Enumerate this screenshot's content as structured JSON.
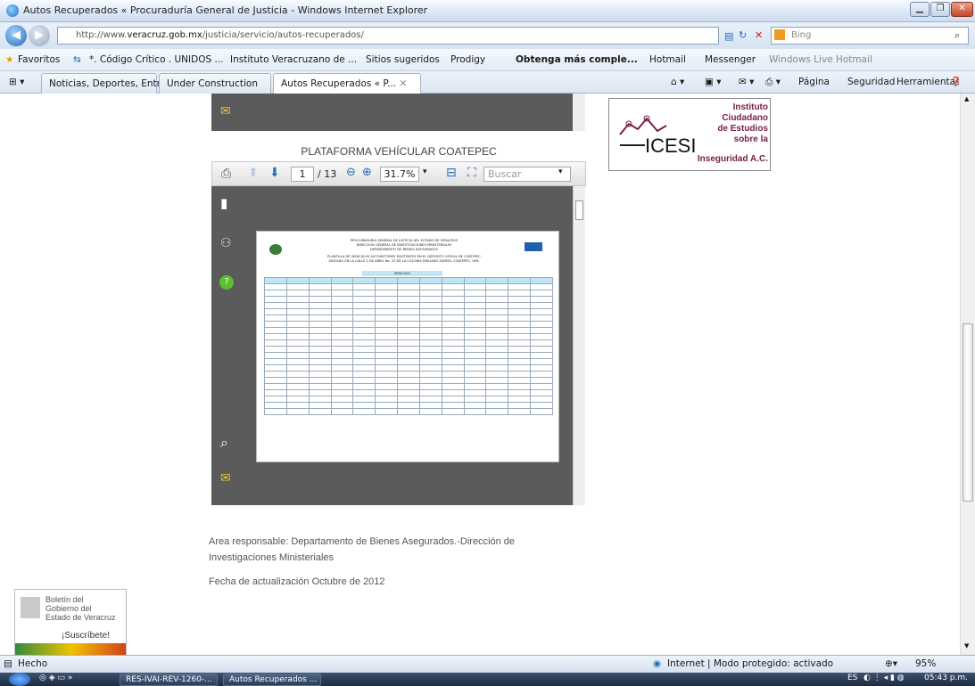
{
  "window": {
    "title": "Autos Recuperados « Procuraduría General de Justicia - Windows Internet Explorer"
  },
  "address": {
    "url_prefix": "http://www.",
    "url_domain": "veracruz.gob.mx",
    "url_path": "/justicia/servicio/autos-recuperados/",
    "search_placeholder": "Bing"
  },
  "favorites": {
    "label": "Favoritos",
    "items": [
      "*. Código Crítico . UNIDOS ...",
      "Instituto Veracruzano de ...",
      "Sitios sugeridos",
      "Prodigy",
      "Obtenga más comple...",
      "Hotmail",
      "Messenger",
      "Windows Live Hotmail"
    ]
  },
  "tabs": [
    {
      "label": "Noticias, Deportes, Entrete..."
    },
    {
      "label": "Under Construction"
    },
    {
      "label": "Autos Recuperados « P..."
    }
  ],
  "toolbar": {
    "pagina": "Página",
    "seguridad": "Seguridad",
    "herramientas": "Herramientas"
  },
  "viewer": {
    "heading": "PLATAFORMA VEHÍCULAR COATEPEC",
    "page": "1",
    "pages": "/ 13",
    "zoom": "31.7%",
    "search_placeholder": "Buscar"
  },
  "sidebar_ad": {
    "l1": "Instituto",
    "l2": "Ciudadano",
    "l3": "de Estudios",
    "l4": "sobre la",
    "l5": "Inseguridad A.C.",
    "logo": "ICESI"
  },
  "pdf": {
    "h1": "PROCURADURIA GENERAL DE JUSTICIA DEL ESTADO DE VERACRUZ",
    "h2": "DIRECCION GENERAL DE INVESTIGACIONES MINISTERIALES",
    "h3": "DEPARTAMENTO DE BIENES ASEGURADOS",
    "h4": "PLANTILLA DE VEHICULOS AUTOMOTORES EXISTENTES EN EL DEPOSITO OFICIAL DE COATEPEC",
    "h5": "UBICADO EN LA CALLE 2 DE ABRIL No. 37 DE LA COLONIA EMILIANO ZAPATA, COATEPEC, VER.",
    "band": "VEHICULO"
  },
  "page": {
    "area": "Area responsable: Departamento de Bienes Asegurados.-Dirección de Investigaciones Ministeriales",
    "fecha": "Fecha de actualización Octubre de 2012"
  },
  "boletin": {
    "l1": "Boletín del",
    "l2": "Gobierno del",
    "l3": "Estado de Veracruz",
    "l4": "¡Suscríbete!"
  },
  "status": {
    "left": "Hecho",
    "zone": "Internet | Modo protegido: activado",
    "zoom": "95%"
  },
  "taskbar": {
    "b1": "RES-IVAI-REV-1260-...",
    "b2": "Autos Recuperados ...",
    "lang": "ES",
    "clock": "05:43 p.m."
  }
}
